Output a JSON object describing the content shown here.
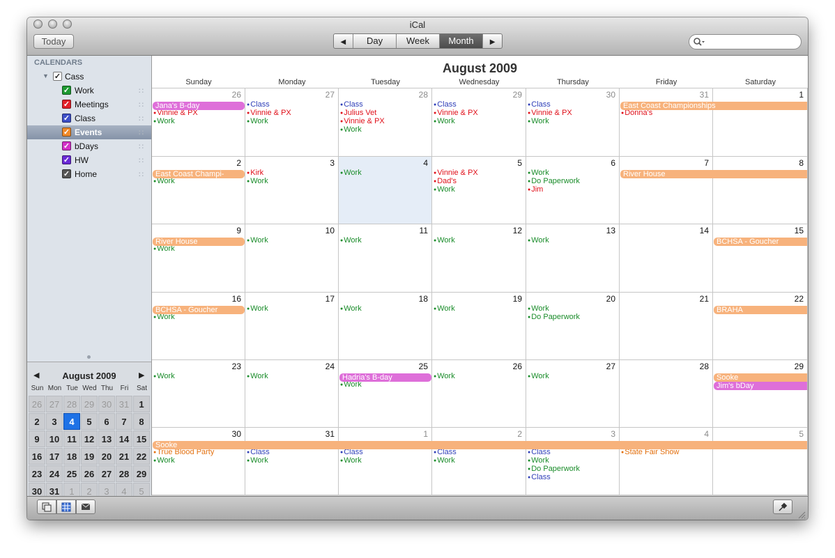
{
  "window": {
    "title": "iCal"
  },
  "toolbar": {
    "today_label": "Today",
    "prev_icon": "◀",
    "next_icon": "▶",
    "views": [
      "Day",
      "Week",
      "Month"
    ],
    "selected_view": "Month",
    "search_placeholder": ""
  },
  "sidebar": {
    "header": "CALENDARS",
    "group": {
      "name": "Cass",
      "expanded": true
    },
    "calendars": [
      {
        "name": "Work",
        "color": "#1e9a32",
        "checked": true,
        "selected": false
      },
      {
        "name": "Meetings",
        "color": "#e2202a",
        "checked": true,
        "selected": false
      },
      {
        "name": "Class",
        "color": "#3d4fc8",
        "checked": true,
        "selected": false
      },
      {
        "name": "Events",
        "color": "#f08a2a",
        "checked": true,
        "selected": true
      },
      {
        "name": "bDays",
        "color": "#d330c8",
        "checked": true,
        "selected": false
      },
      {
        "name": "HW",
        "color": "#6a2ad6",
        "checked": true,
        "selected": false
      },
      {
        "name": "Home",
        "color": "#555555",
        "checked": true,
        "selected": false
      }
    ]
  },
  "mini_calendar": {
    "title": "August 2009",
    "dow": [
      "Sun",
      "Mon",
      "Tue",
      "Wed",
      "Thu",
      "Fri",
      "Sat"
    ],
    "weeks": [
      [
        {
          "d": "26",
          "out": true
        },
        {
          "d": "27",
          "out": true
        },
        {
          "d": "28",
          "out": true
        },
        {
          "d": "29",
          "out": true
        },
        {
          "d": "30",
          "out": true
        },
        {
          "d": "31",
          "out": true
        },
        {
          "d": "1"
        }
      ],
      [
        {
          "d": "2"
        },
        {
          "d": "3"
        },
        {
          "d": "4",
          "today": true
        },
        {
          "d": "5"
        },
        {
          "d": "6"
        },
        {
          "d": "7"
        },
        {
          "d": "8"
        }
      ],
      [
        {
          "d": "9"
        },
        {
          "d": "10"
        },
        {
          "d": "11"
        },
        {
          "d": "12"
        },
        {
          "d": "13"
        },
        {
          "d": "14"
        },
        {
          "d": "15"
        }
      ],
      [
        {
          "d": "16"
        },
        {
          "d": "17"
        },
        {
          "d": "18"
        },
        {
          "d": "19"
        },
        {
          "d": "20"
        },
        {
          "d": "21"
        },
        {
          "d": "22"
        }
      ],
      [
        {
          "d": "23"
        },
        {
          "d": "24"
        },
        {
          "d": "25"
        },
        {
          "d": "26"
        },
        {
          "d": "27"
        },
        {
          "d": "28"
        },
        {
          "d": "29"
        }
      ],
      [
        {
          "d": "30"
        },
        {
          "d": "31"
        },
        {
          "d": "1",
          "out": true
        },
        {
          "d": "2",
          "out": true
        },
        {
          "d": "3",
          "out": true
        },
        {
          "d": "4",
          "out": true
        },
        {
          "d": "5",
          "out": true
        }
      ]
    ]
  },
  "month": {
    "title": "August 2009",
    "weekdays": [
      "Sunday",
      "Monday",
      "Tuesday",
      "Wednesday",
      "Thursday",
      "Friday",
      "Saturday"
    ],
    "event_colors": {
      "Work": "#1a8c2a",
      "Meetings": "#e0101a",
      "Class": "#2f3fb8",
      "Events": "#f7b27c",
      "bDays": "#de6fd9",
      "EventsText": "#e3700f"
    },
    "weeks": [
      {
        "days": [
          {
            "d": "26",
            "out": true,
            "events": [
              {
                "t": "Vinnie & PX",
                "c": "Meetings"
              },
              {
                "t": "Work",
                "c": "Work"
              }
            ]
          },
          {
            "d": "27",
            "out": true,
            "events": [
              {
                "t": "Class",
                "c": "Class"
              },
              {
                "t": "Vinnie & PX",
                "c": "Meetings"
              },
              {
                "t": "Work",
                "c": "Work"
              }
            ]
          },
          {
            "d": "28",
            "out": true,
            "events": [
              {
                "t": "Class",
                "c": "Class"
              },
              {
                "t": "Julius Vet",
                "c": "Meetings"
              },
              {
                "t": "Vinnie & PX",
                "c": "Meetings"
              },
              {
                "t": "Work",
                "c": "Work"
              }
            ]
          },
          {
            "d": "29",
            "out": true,
            "events": [
              {
                "t": "Class",
                "c": "Class"
              },
              {
                "t": "Vinnie & PX",
                "c": "Meetings"
              },
              {
                "t": "Work",
                "c": "Work"
              }
            ]
          },
          {
            "d": "30",
            "out": true,
            "events": [
              {
                "t": "Class",
                "c": "Class"
              },
              {
                "t": "Vinnie & PX",
                "c": "Meetings"
              },
              {
                "t": "Work",
                "c": "Work"
              }
            ]
          },
          {
            "d": "31",
            "out": true,
            "events": [
              {
                "t": "Donna's",
                "c": "Meetings"
              }
            ]
          },
          {
            "d": "1",
            "events": []
          }
        ],
        "bars": [
          {
            "t": "Jana's B-day",
            "start": 0,
            "end": 0,
            "c": "bDays",
            "row": 0
          },
          {
            "t": "East Coast Championships",
            "start": 5,
            "end": 6,
            "c": "Events",
            "row": 0
          }
        ]
      },
      {
        "days": [
          {
            "d": "2",
            "events": [
              {
                "t": "Work",
                "c": "Work"
              }
            ]
          },
          {
            "d": "3",
            "events": [
              {
                "t": "Kirk",
                "c": "Meetings"
              },
              {
                "t": "Work",
                "c": "Work"
              }
            ]
          },
          {
            "d": "4",
            "today": true,
            "events": [
              {
                "t": "Work",
                "c": "Work"
              }
            ]
          },
          {
            "d": "5",
            "events": [
              {
                "t": "Vinnie & PX",
                "c": "Meetings"
              },
              {
                "t": "Dad's",
                "c": "Meetings"
              },
              {
                "t": "Work",
                "c": "Work"
              }
            ]
          },
          {
            "d": "6",
            "events": [
              {
                "t": "Work",
                "c": "Work"
              },
              {
                "t": "Do Paperwork",
                "c": "Work"
              },
              {
                "t": "Jim",
                "c": "Meetings"
              }
            ]
          },
          {
            "d": "7",
            "events": []
          },
          {
            "d": "8",
            "events": []
          }
        ],
        "bars": [
          {
            "t": "East Coast Champi-",
            "start": 0,
            "end": 0,
            "c": "Events",
            "row": 0
          },
          {
            "t": "River House",
            "start": 5,
            "end": 6,
            "c": "Events",
            "row": 0
          }
        ]
      },
      {
        "days": [
          {
            "d": "9",
            "events": [
              {
                "t": "Work",
                "c": "Work"
              }
            ]
          },
          {
            "d": "10",
            "events": [
              {
                "t": "Work",
                "c": "Work"
              }
            ]
          },
          {
            "d": "11",
            "events": [
              {
                "t": "Work",
                "c": "Work"
              }
            ]
          },
          {
            "d": "12",
            "events": [
              {
                "t": "Work",
                "c": "Work"
              }
            ]
          },
          {
            "d": "13",
            "events": [
              {
                "t": "Work",
                "c": "Work"
              }
            ]
          },
          {
            "d": "14",
            "events": []
          },
          {
            "d": "15",
            "events": []
          }
        ],
        "bars": [
          {
            "t": "River House",
            "start": 0,
            "end": 0,
            "c": "Events",
            "row": 0
          },
          {
            "t": "BCHSA - Goucher",
            "start": 6,
            "end": 6,
            "c": "Events",
            "row": 0
          }
        ]
      },
      {
        "days": [
          {
            "d": "16",
            "events": [
              {
                "t": "Work",
                "c": "Work"
              }
            ]
          },
          {
            "d": "17",
            "events": [
              {
                "t": "Work",
                "c": "Work"
              }
            ]
          },
          {
            "d": "18",
            "events": [
              {
                "t": "Work",
                "c": "Work"
              }
            ]
          },
          {
            "d": "19",
            "events": [
              {
                "t": "Work",
                "c": "Work"
              }
            ]
          },
          {
            "d": "20",
            "events": [
              {
                "t": "Work",
                "c": "Work"
              },
              {
                "t": "Do Paperwork",
                "c": "Work"
              }
            ]
          },
          {
            "d": "21",
            "events": []
          },
          {
            "d": "22",
            "events": []
          }
        ],
        "bars": [
          {
            "t": "BCHSA - Goucher",
            "start": 0,
            "end": 0,
            "c": "Events",
            "row": 0
          },
          {
            "t": "BRAHA",
            "start": 6,
            "end": 6,
            "c": "Events",
            "row": 0
          }
        ]
      },
      {
        "days": [
          {
            "d": "23",
            "events": [
              {
                "t": "Work",
                "c": "Work"
              }
            ]
          },
          {
            "d": "24",
            "events": [
              {
                "t": "Work",
                "c": "Work"
              }
            ]
          },
          {
            "d": "25",
            "events": [
              {
                "t": "Work",
                "c": "Work"
              }
            ]
          },
          {
            "d": "26",
            "events": [
              {
                "t": "Work",
                "c": "Work"
              }
            ]
          },
          {
            "d": "27",
            "events": [
              {
                "t": "Work",
                "c": "Work"
              }
            ]
          },
          {
            "d": "28",
            "events": []
          },
          {
            "d": "29",
            "events": []
          }
        ],
        "bars": [
          {
            "t": "Hadria's B-day",
            "start": 2,
            "end": 2,
            "c": "bDays",
            "row": 0
          },
          {
            "t": "Sooke",
            "start": 6,
            "end": 6,
            "c": "Events",
            "row": 0
          },
          {
            "t": "Jim's bDay",
            "start": 6,
            "end": 6,
            "c": "bDays",
            "row": 1
          }
        ]
      },
      {
        "days": [
          {
            "d": "30",
            "events": [
              {
                "t": "True Blood Party",
                "c": "EventsText"
              },
              {
                "t": "Work",
                "c": "Work"
              }
            ]
          },
          {
            "d": "31",
            "events": [
              {
                "t": "Class",
                "c": "Class"
              },
              {
                "t": "Work",
                "c": "Work"
              }
            ]
          },
          {
            "d": "1",
            "out": true,
            "events": [
              {
                "t": "Class",
                "c": "Class"
              },
              {
                "t": "Work",
                "c": "Work"
              }
            ]
          },
          {
            "d": "2",
            "out": true,
            "events": [
              {
                "t": "Class",
                "c": "Class"
              },
              {
                "t": "Work",
                "c": "Work"
              }
            ]
          },
          {
            "d": "3",
            "out": true,
            "events": [
              {
                "t": "Class",
                "c": "Class"
              },
              {
                "t": "Work",
                "c": "Work"
              },
              {
                "t": "Do Paperwork",
                "c": "Work"
              },
              {
                "t": "Class",
                "c": "Class"
              }
            ]
          },
          {
            "d": "4",
            "out": true,
            "events": [
              {
                "t": "State Fair Show",
                "c": "EventsText"
              }
            ]
          },
          {
            "d": "5",
            "out": true,
            "events": []
          }
        ],
        "bars": [
          {
            "t": "Sooke",
            "start": 0,
            "end": 6,
            "c": "Events",
            "row": 0
          }
        ]
      }
    ]
  },
  "bottom": {
    "icons": [
      "calendars-list-icon",
      "mini-calendar-icon",
      "mail-icon",
      "pin-icon"
    ]
  }
}
